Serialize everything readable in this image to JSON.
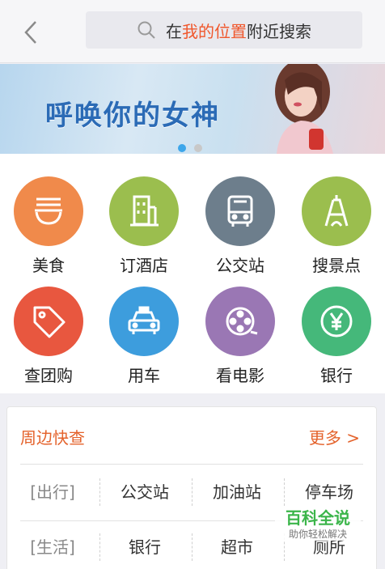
{
  "header": {
    "search_prefix": "在",
    "search_highlight": "我的位置",
    "search_suffix": "附近搜索"
  },
  "banner": {
    "headline": "呼唤你的女神",
    "page_count": 2,
    "active_page": 1
  },
  "categories": [
    {
      "label": "美食",
      "icon": "noodle-bowl-icon",
      "color": "#f08a4b"
    },
    {
      "label": "订酒店",
      "icon": "hotel-building-icon",
      "color": "#9bbe4e"
    },
    {
      "label": "公交站",
      "icon": "bus-icon",
      "color": "#6d7e8c"
    },
    {
      "label": "搜景点",
      "icon": "tower-icon",
      "color": "#9bbe4e"
    },
    {
      "label": "查团购",
      "icon": "tag-icon",
      "color": "#e8573f"
    },
    {
      "label": "用车",
      "icon": "taxi-icon",
      "color": "#3d9ddd"
    },
    {
      "label": "看电影",
      "icon": "film-reel-icon",
      "color": "#9a77b4"
    },
    {
      "label": "银行",
      "icon": "yen-icon",
      "color": "#45b87a"
    }
  ],
  "nearby": {
    "title": "周边快查",
    "more": "更多 >",
    "rows": [
      {
        "tag": "[出行]",
        "items": [
          "公交站",
          "加油站",
          "停车场"
        ]
      },
      {
        "tag": "[生活]",
        "items": [
          "银行",
          "超市",
          "厕所"
        ]
      }
    ]
  },
  "watermark": {
    "title": "百科全说",
    "subtitle": "助你轻松解决"
  }
}
